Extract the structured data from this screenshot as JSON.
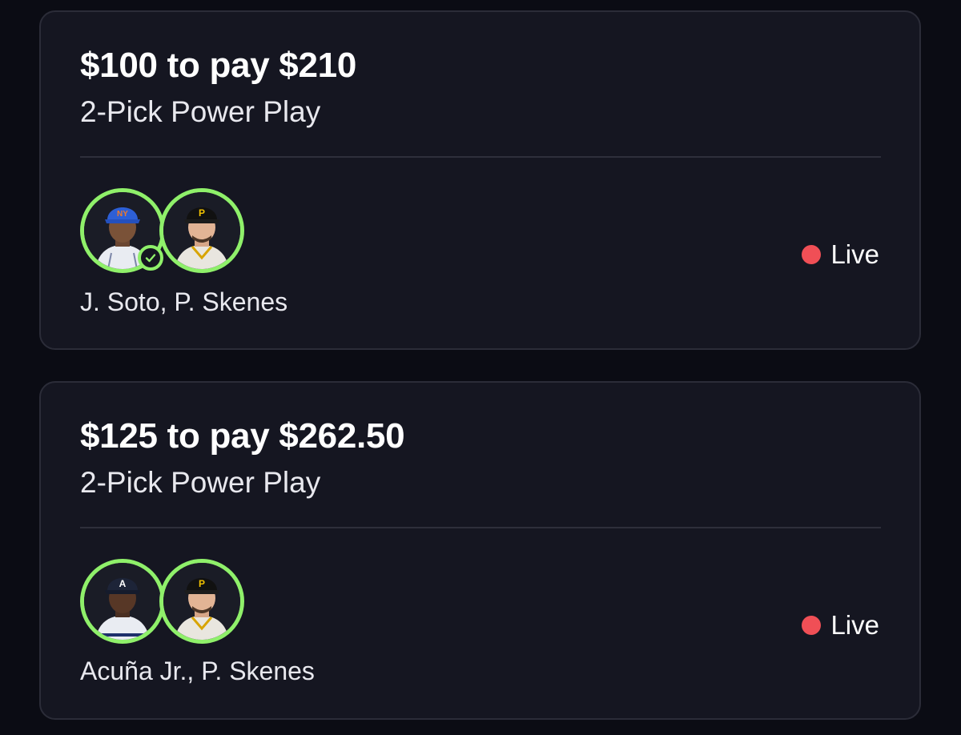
{
  "entries": [
    {
      "title": "$100 to pay $210",
      "subtitle": "2-Pick Power Play",
      "players": "J. Soto, P. Skenes",
      "status": "Live",
      "avatars": [
        {
          "icon": "player-avatar-mets",
          "cap_color": "#2d5fd6",
          "logo": "NY",
          "jersey": "#e9ecf2",
          "check": true
        },
        {
          "icon": "player-avatar-pirates",
          "cap_color": "#111111",
          "logo": "P",
          "jersey": "#e9e6df",
          "check": false
        }
      ]
    },
    {
      "title": "$125 to pay $262.50",
      "subtitle": "2-Pick Power Play",
      "players": "Acuña Jr., P. Skenes",
      "status": "Live",
      "avatars": [
        {
          "icon": "player-avatar-braves",
          "cap_color": "#1d2438",
          "logo": "A",
          "jersey": "#e9ecf2",
          "check": false
        },
        {
          "icon": "player-avatar-pirates",
          "cap_color": "#111111",
          "logo": "P",
          "jersey": "#e9e6df",
          "check": false
        }
      ]
    }
  ],
  "colors": {
    "accent_green": "#8ff06a",
    "live_red": "#f04f56",
    "card_bg": "#151621",
    "page_bg": "#0b0c14"
  }
}
